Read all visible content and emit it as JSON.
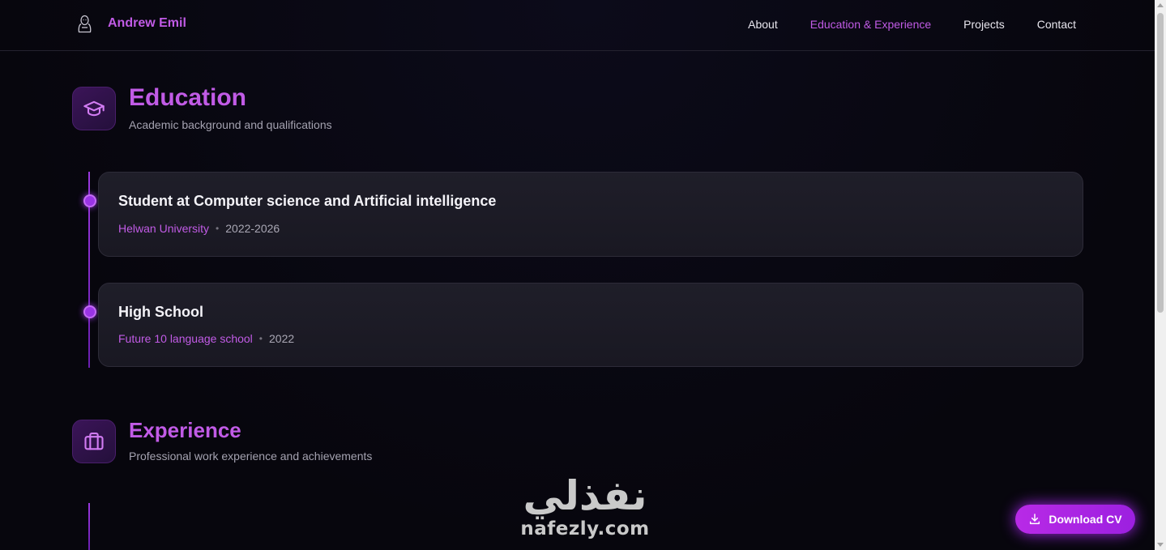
{
  "header": {
    "brand_name": "Andrew Emil",
    "nav": [
      {
        "label": "About",
        "active": false
      },
      {
        "label": "Education & Experience",
        "active": true
      },
      {
        "label": "Projects",
        "active": false
      },
      {
        "label": "Contact",
        "active": false
      }
    ]
  },
  "education": {
    "title": "Education",
    "subtitle": "Academic background and qualifications",
    "icon": "graduation-cap-icon",
    "items": [
      {
        "title": "Student at Computer science and Artificial intelligence",
        "org": "Helwan University",
        "date": "2022-2026"
      },
      {
        "title": "High School",
        "org": "Future 10 language school",
        "date": "2022"
      }
    ]
  },
  "experience": {
    "title": "Experience",
    "subtitle": "Professional work experience and achievements",
    "icon": "briefcase-icon"
  },
  "watermark": {
    "arabic": "نفذلي",
    "latin": "nafezly.com"
  },
  "download": {
    "label": "Download CV",
    "icon": "download-icon"
  },
  "colors": {
    "accent": "#c15be6",
    "background": "#08070f",
    "card": "#1c1b26"
  }
}
